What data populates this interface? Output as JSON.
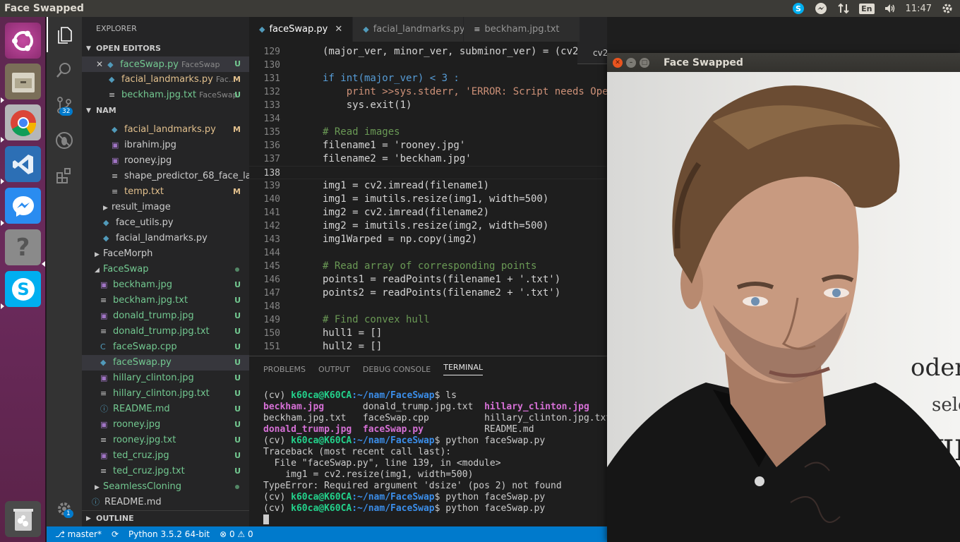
{
  "top_panel": {
    "title": "Face Swapped",
    "lang": "En",
    "clock": "11:47"
  },
  "activity": {
    "scm_badge": "32",
    "settings_badge": "1"
  },
  "sidebar": {
    "title": "EXPLORER",
    "open_editors_label": "OPEN EDITORS",
    "open_editors": [
      {
        "name": "faceSwap.py",
        "desc": "FaceSwap",
        "status": "U"
      },
      {
        "name": "facial_landmarks.py",
        "desc": "Fac...",
        "status": "M"
      },
      {
        "name": "beckham.jpg.txt",
        "desc": "FaceSwap",
        "status": "U"
      }
    ],
    "folder_label": "NAM",
    "tree": [
      {
        "name": "facial_landmarks.py",
        "status": "M"
      },
      {
        "name": "ibrahim.jpg",
        "status": ""
      },
      {
        "name": "rooney.jpg",
        "status": ""
      },
      {
        "name": "shape_predictor_68_face_la...",
        "status": ""
      },
      {
        "name": "temp.txt",
        "status": "M"
      },
      {
        "name": "result_image",
        "status": ""
      },
      {
        "name": "face_utils.py",
        "status": ""
      },
      {
        "name": "facial_landmarks.py",
        "status": ""
      },
      {
        "name": "FaceMorph",
        "status": ""
      },
      {
        "name": "FaceSwap",
        "status": ""
      },
      {
        "name": "beckham.jpg",
        "status": "U"
      },
      {
        "name": "beckham.jpg.txt",
        "status": "U"
      },
      {
        "name": "donald_trump.jpg",
        "status": "U"
      },
      {
        "name": "donald_trump.jpg.txt",
        "status": "U"
      },
      {
        "name": "faceSwap.cpp",
        "status": "U"
      },
      {
        "name": "faceSwap.py",
        "status": "U"
      },
      {
        "name": "hillary_clinton.jpg",
        "status": "U"
      },
      {
        "name": "hillary_clinton.jpg.txt",
        "status": "U"
      },
      {
        "name": "README.md",
        "status": "U"
      },
      {
        "name": "rooney.jpg",
        "status": "U"
      },
      {
        "name": "rooney.jpg.txt",
        "status": "U"
      },
      {
        "name": "ted_cruz.jpg",
        "status": "U"
      },
      {
        "name": "ted_cruz.jpg.txt",
        "status": "U"
      },
      {
        "name": "SeamlessCloning",
        "status": ""
      },
      {
        "name": "README.md",
        "status": ""
      }
    ],
    "outline_label": "OUTLINE"
  },
  "tabs": [
    {
      "label": "faceSwap.py",
      "close": "✕"
    },
    {
      "label": "facial_landmarks.py"
    },
    {
      "label": "beckham.jpg.txt"
    }
  ],
  "editor": {
    "peek_text": "cv2",
    "lines": [
      {
        "n": "129",
        "t": "(major_ver, minor_ver, subminor_ver) = (cv2"
      },
      {
        "n": "130",
        "t": ""
      },
      {
        "n": "131",
        "t": "if int(major_ver) < 3 :"
      },
      {
        "n": "132",
        "t": "    print >>sys.stderr, 'ERROR: Script needs Ope"
      },
      {
        "n": "133",
        "t": "    sys.exit(1)"
      },
      {
        "n": "134",
        "t": ""
      },
      {
        "n": "135",
        "t": "# Read images"
      },
      {
        "n": "136",
        "t": "filename1 = 'rooney.jpg'"
      },
      {
        "n": "137",
        "t": "filename2 = 'beckham.jpg'"
      },
      {
        "n": "138",
        "t": ""
      },
      {
        "n": "139",
        "t": "img1 = cv2.imread(filename1)"
      },
      {
        "n": "140",
        "t": "img1 = imutils.resize(img1, width=500)"
      },
      {
        "n": "141",
        "t": "img2 = cv2.imread(filename2)"
      },
      {
        "n": "142",
        "t": "img2 = imutils.resize(img2, width=500)"
      },
      {
        "n": "143",
        "t": "img1Warped = np.copy(img2)"
      },
      {
        "n": "144",
        "t": ""
      },
      {
        "n": "145",
        "t": "# Read array of corresponding points"
      },
      {
        "n": "146",
        "t": "points1 = readPoints(filename1 + '.txt')"
      },
      {
        "n": "147",
        "t": "points2 = readPoints(filename2 + '.txt')"
      },
      {
        "n": "148",
        "t": ""
      },
      {
        "n": "149",
        "t": "# Find convex hull"
      },
      {
        "n": "150",
        "t": "hull1 = []"
      },
      {
        "n": "151",
        "t": "hull2 = []"
      }
    ]
  },
  "panel": {
    "tabs": [
      "PROBLEMS",
      "OUTPUT",
      "DEBUG CONSOLE",
      "TERMINAL"
    ],
    "prompt_env": "(cv) ",
    "prompt_user": "k60ca@K60CA",
    "prompt_path": ":~/nam/FaceSwap",
    "cmd_ls": "$ ls",
    "ls": [
      [
        "beckham.jpg",
        "donald_trump.jpg.txt",
        "hillary_clinton.jpg"
      ],
      [
        "beckham.jpg.txt",
        "faceSwap.cpp",
        "hillary_clinton.jpg.txt"
      ],
      [
        "donald_trump.jpg",
        "faceSwap.py",
        "README.md"
      ]
    ],
    "cmd_run": "$ python faceSwap.py",
    "trace": [
      "Traceback (most recent call last):",
      "  File \"faceSwap.py\", line 139, in <module>",
      "    img1 = cv2.resize(img1, width=500)",
      "TypeError: Required argument 'dsize' (pos 2) not found"
    ]
  },
  "status": {
    "branch": "master*",
    "python": "Python 3.5.2 64-bit",
    "errors": "0",
    "warnings": "0"
  },
  "face_window": {
    "title": "Face Swapped"
  },
  "colors": {
    "accent": "#007acc",
    "launcher": "#5e2750",
    "panel": "#3c3b37"
  }
}
